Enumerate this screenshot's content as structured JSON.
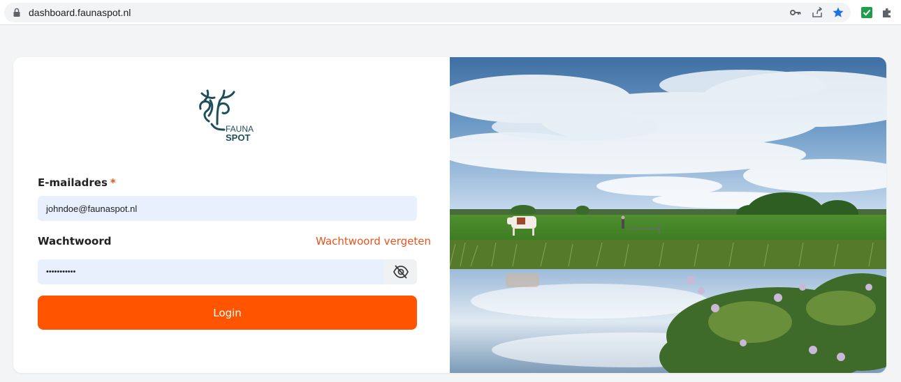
{
  "browser": {
    "url": "dashboard.faunaspot.nl",
    "icons": [
      "lock-icon",
      "key-icon",
      "share-icon",
      "star-icon",
      "checkbox-extension-icon",
      "puzzle-extension-icon"
    ]
  },
  "logo": {
    "text_top": "FAUNA",
    "text_bottom": "SPOT",
    "color": "#1f4e5a"
  },
  "form": {
    "email_label": "E-mailadres",
    "required_mark": "*",
    "email_value": "johndoe@faunaspot.nl",
    "password_label": "Wachtwoord",
    "forgot_link": "Wachtwoord vergeten",
    "password_value": "•••••••••••",
    "eye_icon": "eye-slash-icon",
    "login_button": "Login"
  },
  "colors": {
    "accent": "#ff5500",
    "link": "#e8541c",
    "field_bg": "#e8f0fe"
  },
  "hero_image": {
    "description_icon": "landscape-photo"
  }
}
